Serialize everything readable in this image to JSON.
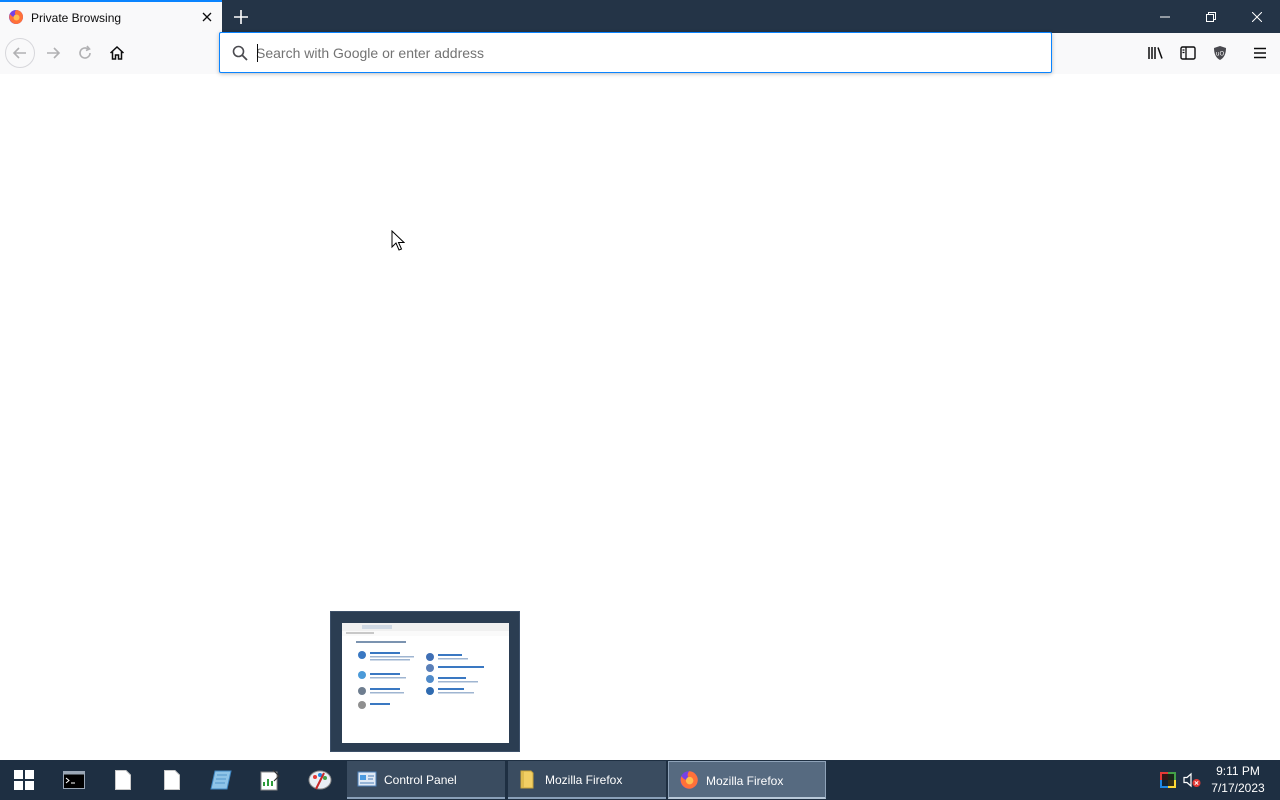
{
  "window": {
    "tab_title": "Private Browsing",
    "controls": [
      "minimize-icon",
      "restore-icon",
      "close-icon"
    ]
  },
  "navbar": {
    "search_placeholder": "Search with Google or enter address",
    "search_value": ""
  },
  "taskbar": {
    "pinned": [
      "terminal-icon",
      "document-icon",
      "document-icon",
      "notebook-icon",
      "spreadsheet-editor-icon",
      "paint-icon"
    ],
    "tasks": [
      {
        "label": "Control Panel",
        "icon": "control-panel-icon",
        "active": false
      },
      {
        "label": "Mozilla Firefox",
        "icon": "folder-icon",
        "active": false
      },
      {
        "label": "Mozilla Firefox",
        "icon": "firefox-icon",
        "active": true
      }
    ],
    "clock": {
      "time": "9:11 PM",
      "date": "7/17/2023"
    }
  },
  "colors": {
    "accent": "#0a84ff",
    "titlebar": "#243447",
    "taskbar": "#1e2f42"
  }
}
